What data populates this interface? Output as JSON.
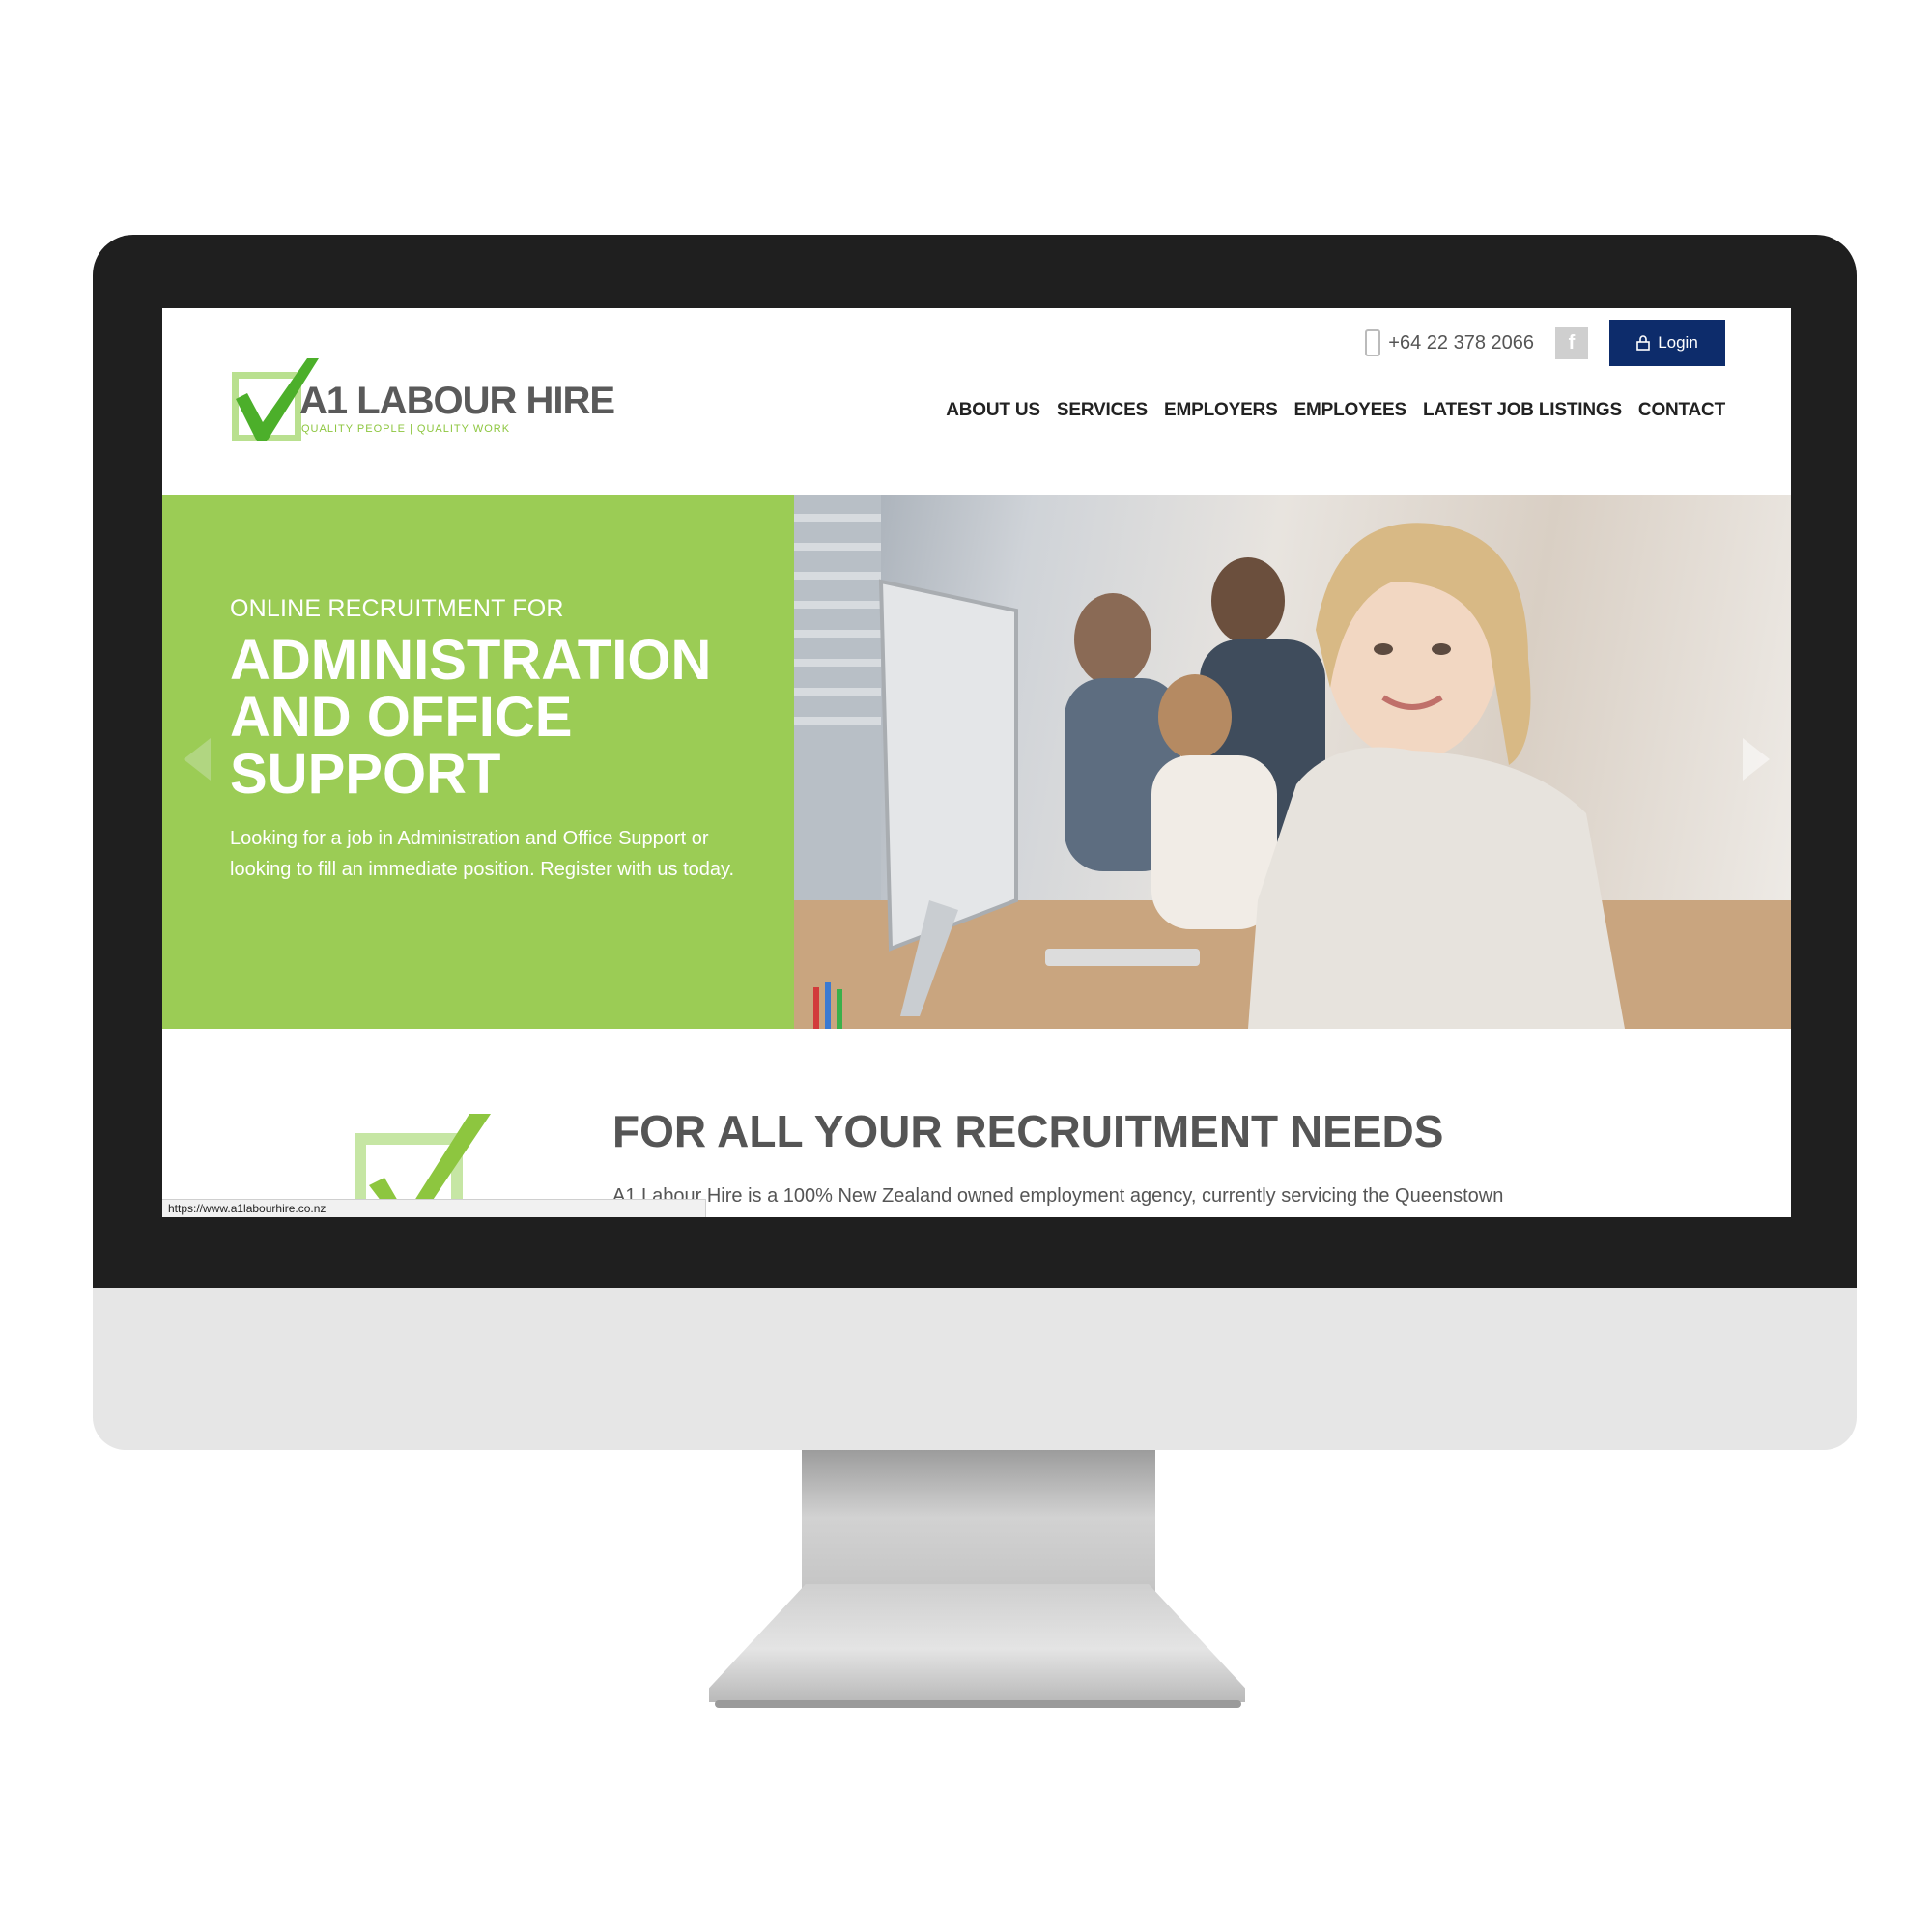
{
  "header": {
    "logo_title": "A1 LABOUR HIRE",
    "logo_tagline": "QUALITY PEOPLE | QUALITY WORK",
    "phone": "+64 22 378 2066",
    "facebook_label": "f",
    "login_label": "Login"
  },
  "nav": {
    "items": [
      "ABOUT US",
      "SERVICES",
      "EMPLOYERS",
      "EMPLOYEES",
      "LATEST JOB LISTINGS",
      "CONTACT"
    ]
  },
  "hero": {
    "kicker": "ONLINE RECRUITMENT FOR",
    "title": "ADMINISTRATION AND OFFICE SUPPORT",
    "description": "Looking for a job in Administration and Office Support or looking to fill an immediate position. Register with us today."
  },
  "intro": {
    "heading": "FOR ALL YOUR RECRUITMENT NEEDS",
    "text": "A1 Labour Hire is a 100% New Zealand owned employment agency, currently servicing the Queenstown"
  },
  "status_bar": {
    "url": "https://www.a1labourhire.co.nz"
  },
  "colors": {
    "brand_green": "#9bcc55",
    "logo_green": "#8dc63f",
    "login_navy": "#0d2c6b",
    "heading_gray": "#555555"
  },
  "icons": [
    "phone-icon",
    "facebook-icon",
    "lock-icon",
    "check-icon",
    "arrow-left-icon",
    "arrow-right-icon"
  ]
}
